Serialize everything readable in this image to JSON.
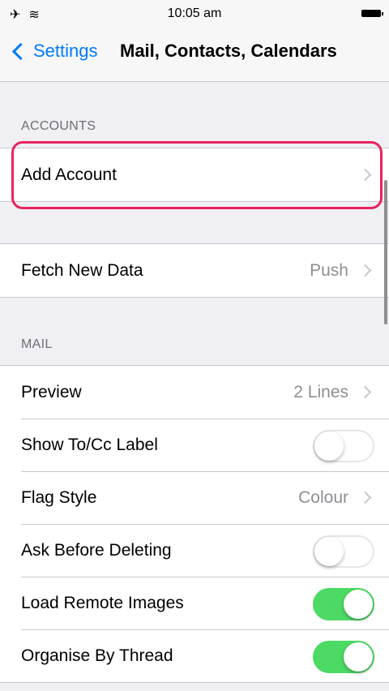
{
  "status_bar": {
    "time": "10:05 am",
    "airplane_icon": "airplane-icon",
    "wifi_icon": "wifi-icon",
    "battery_icon": "battery-icon"
  },
  "nav": {
    "back_label": "Settings",
    "title": "Mail, Contacts, Calendars"
  },
  "accounts": {
    "header": "ACCOUNTS",
    "add_account": "Add Account"
  },
  "fetch": {
    "label": "Fetch New Data",
    "value": "Push"
  },
  "mail": {
    "header": "MAIL",
    "rows": [
      {
        "label": "Preview",
        "value": "2 Lines",
        "type": "disclosure"
      },
      {
        "label": "Show To/Cc Label",
        "type": "toggle",
        "on": false
      },
      {
        "label": "Flag Style",
        "value": "Colour",
        "type": "disclosure"
      },
      {
        "label": "Ask Before Deleting",
        "type": "toggle",
        "on": false
      },
      {
        "label": "Load Remote Images",
        "type": "toggle",
        "on": true
      },
      {
        "label": "Organise By Thread",
        "type": "toggle",
        "on": true
      }
    ]
  },
  "colors": {
    "accent": "#007aff",
    "toggle_on": "#4cd964",
    "highlight": "#e8245f"
  }
}
